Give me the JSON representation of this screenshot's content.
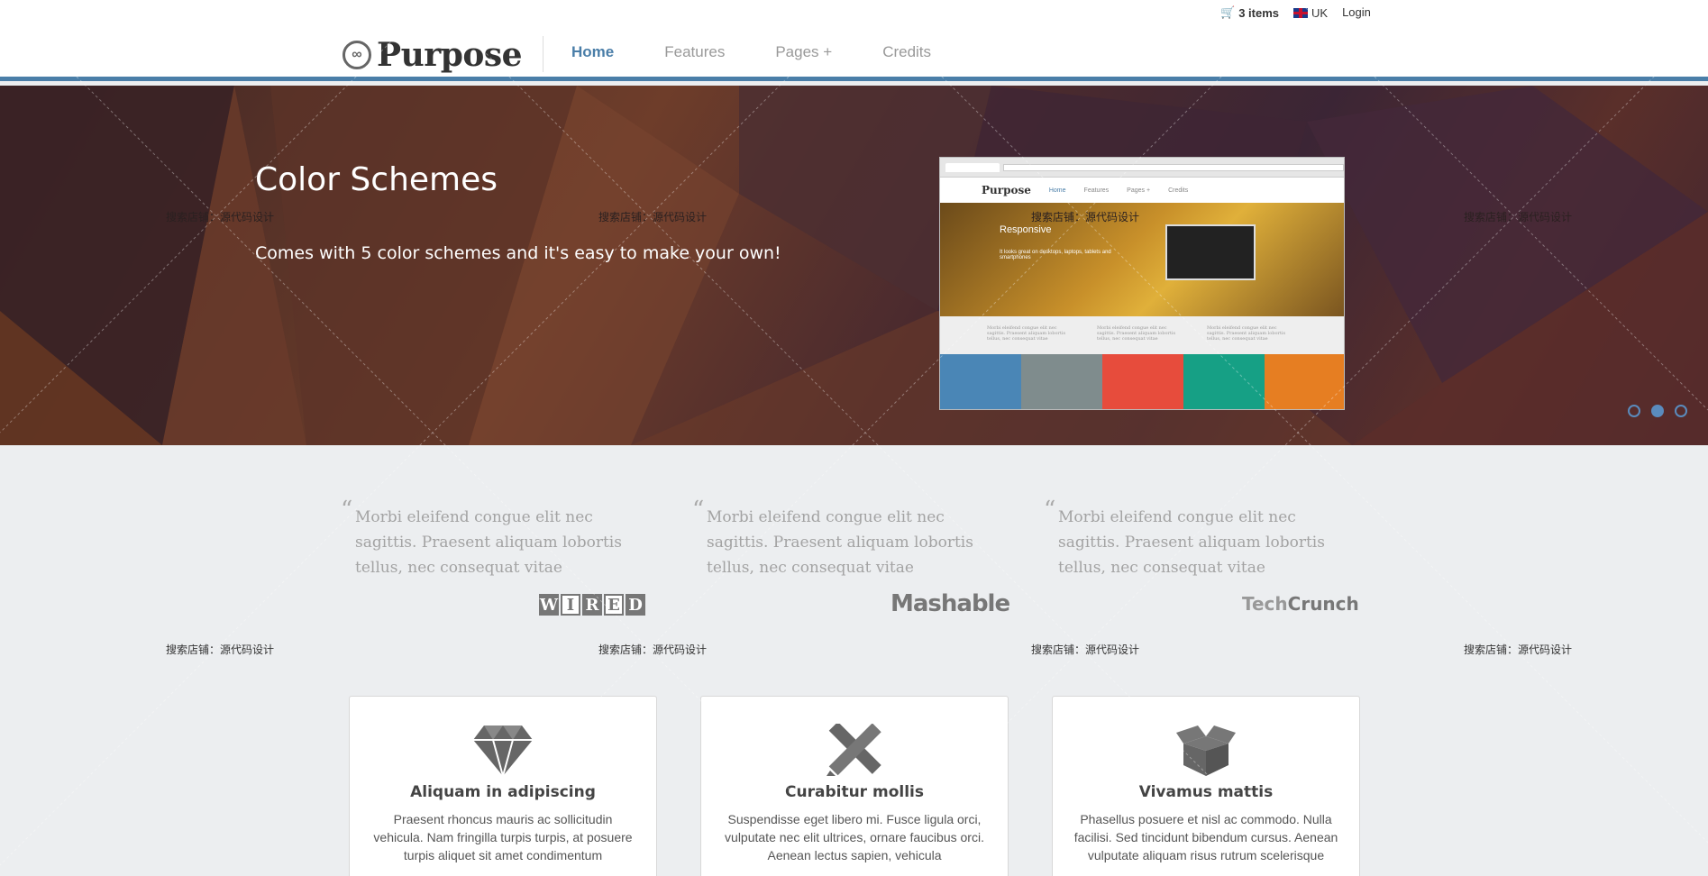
{
  "topbar": {
    "cart": "3 items",
    "lang": "UK",
    "login": "Login"
  },
  "brand": {
    "name": "Purpose"
  },
  "nav": [
    {
      "label": "Home"
    },
    {
      "label": "Features"
    },
    {
      "label": "Pages +"
    },
    {
      "label": "Credits"
    }
  ],
  "hero": {
    "title": "Color Schemes",
    "subtitle": "Comes with 5 color schemes and it's easy to make your own!",
    "slides_total": 3,
    "active_slide": 2,
    "swatch_colors": [
      "#4a86b6",
      "#7f8c8d",
      "#e74c3c",
      "#16a085",
      "#e67e22"
    ],
    "preview": {
      "brand": "Purpose",
      "nav": [
        "Home",
        "Features",
        "Pages +",
        "Credits"
      ],
      "slide_title": "Responsive",
      "slide_text": "It looks great on desktops, laptops, tablets and smartphones",
      "quote": "Morbi eleifend congue elit nec sagittis. Praesent aliquam lobortis tellus, nec consequat vitae"
    }
  },
  "watermark": "搜索店铺：源代码设计",
  "quotes": [
    {
      "text": "Morbi eleifend congue elit nec sagittis. Praesent aliquam lobortis tellus, nec consequat vitae",
      "source": "WIRED"
    },
    {
      "text": "Morbi eleifend congue elit nec sagittis. Praesent aliquam lobortis tellus, nec consequat vitae",
      "source": "Mashable"
    },
    {
      "text": "Morbi eleifend congue elit nec sagittis. Praesent aliquam lobortis tellus, nec consequat vitae",
      "source": "TechCrunch"
    }
  ],
  "features": [
    {
      "icon": "diamond-icon",
      "title": "Aliquam in adipiscing",
      "text": "Praesent rhoncus mauris ac sollicitudin vehicula. Nam fringilla turpis turpis, at posuere turpis aliquet sit amet condimentum"
    },
    {
      "icon": "pencil-ruler-icon",
      "title": "Curabitur mollis",
      "text": "Suspendisse eget libero mi. Fusce ligula orci, vulputate nec elit ultrices, ornare faucibus orci. Aenean lectus sapien, vehicula"
    },
    {
      "icon": "open-box-icon",
      "title": "Vivamus mattis",
      "text": "Phasellus posuere et nisl ac commodo. Nulla facilisi. Sed tincidunt bibendum cursus. Aenean vulputate aliquam risus rutrum scelerisque"
    }
  ],
  "colors": {
    "accent": "#4a7ea8",
    "hero_bg": "#4a2a2e",
    "page_bg": "#eceef0"
  }
}
